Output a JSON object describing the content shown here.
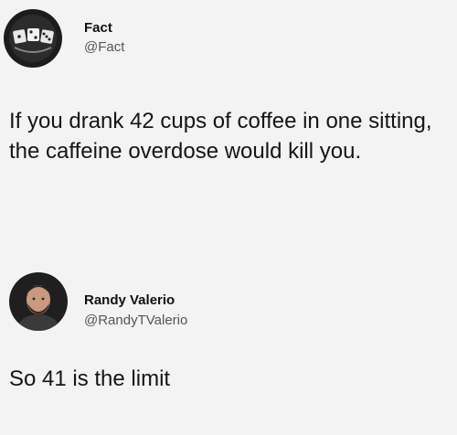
{
  "posts": [
    {
      "name": "Fact",
      "handle": "@Fact",
      "text": "If you drank 42 cups of coffee in one sitting, the caffeine overdose would kill you.",
      "avatar_icon": "dice-logo"
    },
    {
      "name": "Randy Valerio",
      "handle": "@RandyTValerio",
      "text": "So 41 is the limit",
      "avatar_icon": "profile-photo"
    }
  ]
}
